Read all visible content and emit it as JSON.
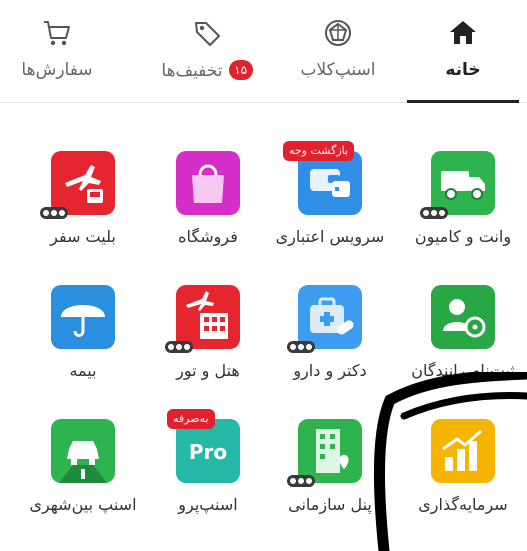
{
  "tabs": [
    {
      "key": "home",
      "label": "خانه",
      "active": true,
      "icon": "home-icon"
    },
    {
      "key": "club",
      "label": "اسنپ‌کلاب",
      "active": false,
      "icon": "diamond-icon"
    },
    {
      "key": "discounts",
      "label": "تخفیف‌ها",
      "active": false,
      "icon": "tag-icon",
      "badge": "۱۵"
    },
    {
      "key": "orders",
      "label": "سفارش‌ها",
      "active": false,
      "icon": "cart-icon"
    }
  ],
  "services": [
    {
      "label": "وانت و کامیون",
      "icon": "truck-icon",
      "color": "#2eb34f"
    },
    {
      "label": "سرویس اعتباری",
      "icon": "wallet-icon",
      "color": "#2f8fe8",
      "tag": "بازگشت وجه"
    },
    {
      "label": "فروشگاه",
      "icon": "shopping-bag-icon",
      "color": "#d62fc9"
    },
    {
      "label": "بلیت سفر",
      "icon": "plane-bus-icon",
      "color": "#e5262f"
    },
    {
      "label": "ثبت‌نام رانندگان",
      "icon": "driver-icon",
      "color": "#28a745"
    },
    {
      "label": "دکتر و دارو",
      "icon": "medkit-icon",
      "color": "#3b9cf0"
    },
    {
      "label": "هتل و تور",
      "icon": "hotel-icon",
      "color": "#e5262f"
    },
    {
      "label": "بیمه",
      "icon": "umbrella-icon",
      "color": "#2b8fe0"
    },
    {
      "label": "سرمایه‌گذاری",
      "icon": "chart-icon",
      "color": "#f4b400"
    },
    {
      "label": "پنل سازمانی",
      "icon": "building-icon",
      "color": "#2eb34f"
    },
    {
      "label": "اسنپ‌پرو",
      "icon": "pro-icon",
      "color": "#25b8a6",
      "tag": "به‌صرفه",
      "icon_text": "Pro"
    },
    {
      "label": "اسنپ بین‌شهری",
      "icon": "intercity-car-icon",
      "color": "#2eb34f"
    }
  ],
  "colors": {
    "accent_red": "#e0212e",
    "text": "#333333",
    "active_tab": "#222222"
  }
}
